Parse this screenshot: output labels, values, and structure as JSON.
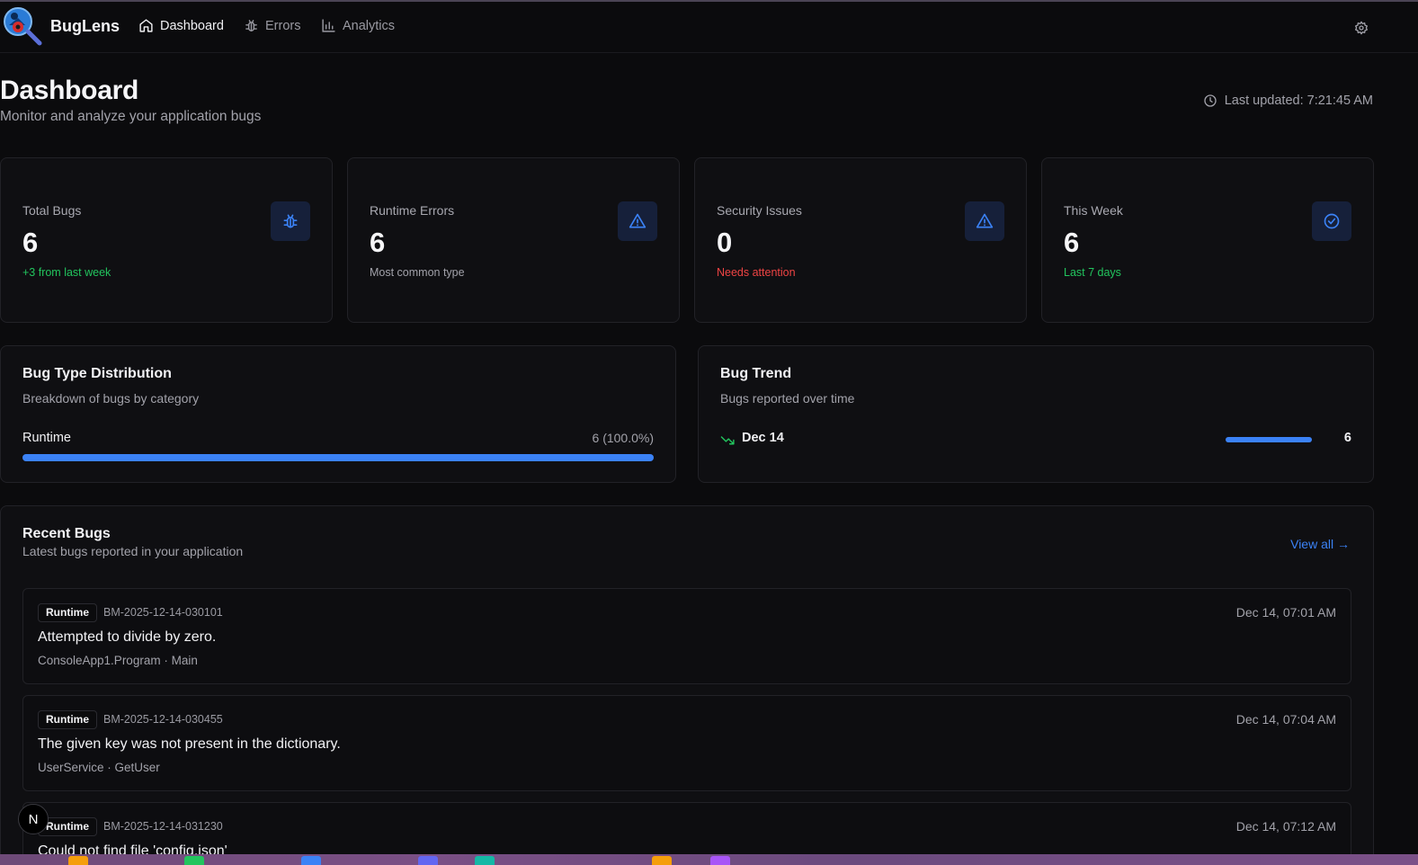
{
  "app": {
    "name": "BugLens"
  },
  "nav": [
    {
      "label": "Dashboard",
      "icon": "home-icon",
      "active": true
    },
    {
      "label": "Errors",
      "icon": "bug-icon",
      "active": false
    },
    {
      "label": "Analytics",
      "icon": "bar-chart-icon",
      "active": false
    }
  ],
  "header": {
    "title": "Dashboard",
    "subtitle": "Monitor and analyze your application bugs",
    "last_updated": "Last updated: 7:21:45 AM"
  },
  "stats": [
    {
      "label": "Total Bugs",
      "value": "6",
      "note": "+3 from last week",
      "note_color": "green",
      "icon": "bug-icon"
    },
    {
      "label": "Runtime Errors",
      "value": "6",
      "note": "Most common type",
      "note_color": "grey",
      "icon": "warning-triangle-icon"
    },
    {
      "label": "Security Issues",
      "value": "0",
      "note": "Needs attention",
      "note_color": "red",
      "icon": "warning-triangle-icon"
    },
    {
      "label": "This Week",
      "value": "6",
      "note": "Last 7 days",
      "note_color": "green",
      "icon": "check-circle-icon"
    }
  ],
  "distribution": {
    "title": "Bug Type Distribution",
    "subtitle": "Breakdown of bugs by category",
    "items": [
      {
        "label": "Runtime",
        "count_text": "6 (100.0%)",
        "fraction": 1.0
      }
    ]
  },
  "trend": {
    "title": "Bug Trend",
    "subtitle": "Bugs reported over time",
    "items": [
      {
        "date": "Dec 14",
        "value": "6",
        "fraction": 1.0
      }
    ]
  },
  "recent": {
    "title": "Recent Bugs",
    "subtitle": "Latest bugs reported in your application",
    "view_all": "View all →",
    "bugs": [
      {
        "type": "Runtime",
        "id": "BM-2025-12-14-030101",
        "time": "Dec 14, 07:01 AM",
        "message": "Attempted to divide by zero.",
        "source": "ConsoleApp1.Program · Main"
      },
      {
        "type": "Runtime",
        "id": "BM-2025-12-14-030455",
        "time": "Dec 14, 07:04 AM",
        "message": "The given key was not present in the dictionary.",
        "source": "UserService · GetUser"
      },
      {
        "type": "Runtime",
        "id": "BM-2025-12-14-031230",
        "time": "Dec 14, 07:12 AM",
        "message": "Could not find file 'config.json'",
        "source": ""
      }
    ]
  },
  "overlay": {
    "n_badge": "N"
  },
  "colors": {
    "accent": "#3b82f6",
    "success": "#22c55e",
    "danger": "#ef4444",
    "background": "#0b0b0d",
    "card": "#0f0f12"
  }
}
